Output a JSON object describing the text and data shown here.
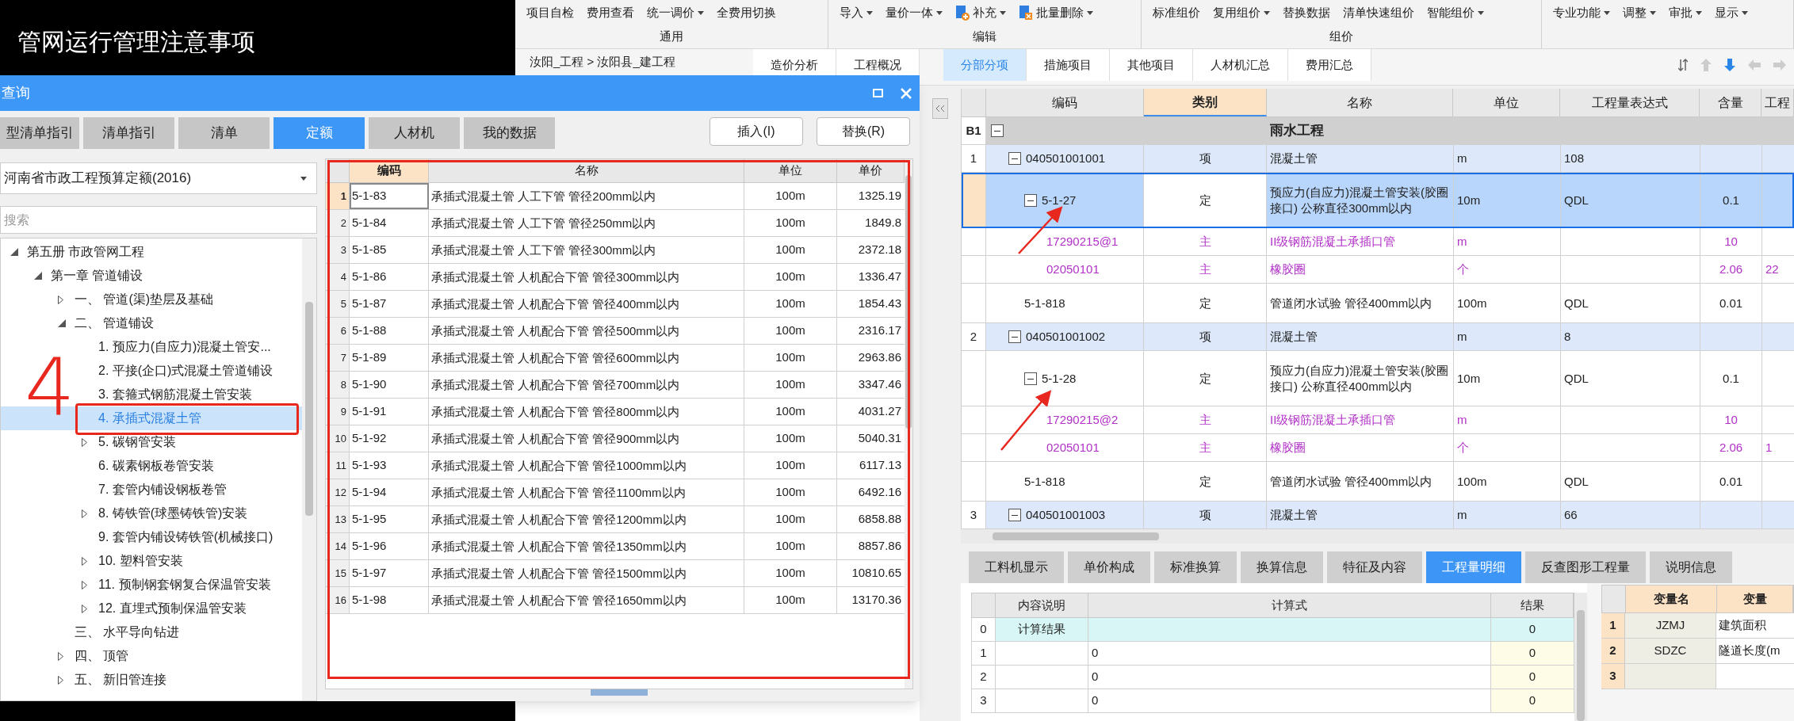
{
  "background_title": "管网运行管理注意事项",
  "ribbon": {
    "groups": [
      {
        "label": "通用",
        "items": [
          {
            "label": "项目自检",
            "dropdown": false
          },
          {
            "label": "费用查看",
            "dropdown": false
          },
          {
            "label": "统一调价",
            "dropdown": true
          },
          {
            "label": "全费用切换",
            "dropdown": false
          }
        ]
      },
      {
        "label": "编辑",
        "items": [
          {
            "label": "导入",
            "dropdown": true
          },
          {
            "label": "量价一体",
            "dropdown": true
          },
          {
            "label": "补充",
            "dropdown": true,
            "kind": "add"
          },
          {
            "label": "批量删除",
            "dropdown": true,
            "kind": "delete"
          }
        ]
      },
      {
        "label": "组价",
        "items": [
          {
            "label": "标准组价",
            "dropdown": false
          },
          {
            "label": "复用组价",
            "dropdown": true
          },
          {
            "label": "替换数据",
            "dropdown": false
          },
          {
            "label": "清单快速组价",
            "dropdown": false
          },
          {
            "label": "智能组价",
            "dropdown": true
          }
        ]
      },
      {
        "items": [
          {
            "label": "专业功能",
            "dropdown": true
          },
          {
            "label": "调整",
            "dropdown": true
          },
          {
            "label": "审批",
            "dropdown": true
          },
          {
            "label": "显示",
            "dropdown": true
          }
        ]
      }
    ]
  },
  "document_tabs": {
    "breadcrumb": "汝阳_工程 > 汝阳县_建工程",
    "tabs": [
      {
        "label": "造价分析",
        "selected": false
      },
      {
        "label": "工程概况",
        "selected": false
      },
      {
        "label": "分部分项",
        "selected": true
      },
      {
        "label": "措施项目",
        "selected": false
      },
      {
        "label": "其他项目",
        "selected": false
      },
      {
        "label": "人材机汇总",
        "selected": false
      },
      {
        "label": "费用汇总",
        "selected": false
      }
    ]
  },
  "grid": {
    "columns": [
      {
        "label": "编码",
        "selected": false
      },
      {
        "label": "类别",
        "selected": true
      },
      {
        "label": "名称",
        "selected": false
      },
      {
        "label": "单位",
        "selected": false
      },
      {
        "label": "工程量表达式",
        "selected": false
      },
      {
        "label": "含量",
        "selected": false
      },
      {
        "label": "工程",
        "selected": false
      }
    ],
    "rows": [
      {
        "kind": "section",
        "number": "B1",
        "name": "雨水工程",
        "expanded": true,
        "selected": false
      },
      {
        "kind": "item",
        "number": "1",
        "code": "040501001001",
        "type": "项",
        "name": "混凝土管",
        "unit": "m",
        "expression": "108",
        "expanded": true,
        "selected": false
      },
      {
        "kind": "quota",
        "code": "5-1-27",
        "type": "定",
        "name": "预应力(自应力)混凝土管安装(胶圈接口) 公称直径300mm以内",
        "unit": "10m",
        "expression": "QDL",
        "content": "0.1",
        "expanded": true,
        "selected": true
      },
      {
        "kind": "material",
        "code": "17290215@1",
        "type": "主",
        "name": "II级钢筋混凝土承插口管",
        "unit": "m",
        "content": "10",
        "selected": false
      },
      {
        "kind": "material",
        "code": "02050101",
        "type": "主",
        "name": "橡胶圈",
        "unit": "个",
        "content": "2.06",
        "column_8": "22",
        "selected": false
      },
      {
        "kind": "quota",
        "code": "5-1-818",
        "type": "定",
        "name": "管道闭水试验 管径400mm以内",
        "unit": "100m",
        "expression": "QDL",
        "content": "0.01",
        "selected": false
      },
      {
        "kind": "item",
        "number": "2",
        "code": "040501001002",
        "type": "项",
        "name": "混凝土管",
        "unit": "m",
        "expression": "8",
        "expanded": true,
        "selected": false
      },
      {
        "kind": "quota",
        "code": "5-1-28",
        "type": "定",
        "name": "预应力(自应力)混凝土管安装(胶圈接口) 公称直径400mm以内",
        "unit": "10m",
        "expression": "QDL",
        "content": "0.1",
        "expanded": true,
        "selected": false
      },
      {
        "kind": "material",
        "code": "17290215@2",
        "type": "主",
        "name": "II级钢筋混凝土承插口管",
        "unit": "m",
        "content": "10",
        "selected": false
      },
      {
        "kind": "material",
        "code": "02050101",
        "type": "主",
        "name": "橡胶圈",
        "unit": "个",
        "content": "2.06",
        "column_8": "1",
        "selected": false
      },
      {
        "kind": "quota",
        "code": "5-1-818",
        "type": "定",
        "name": "管道闭水试验 管径400mm以内",
        "unit": "100m",
        "expression": "QDL",
        "content": "0.01",
        "selected": false
      },
      {
        "kind": "item",
        "number": "3",
        "code": "040501001003",
        "type": "项",
        "name": "混凝土管",
        "unit": "m",
        "expression": "66",
        "expanded": true,
        "selected": false
      }
    ]
  },
  "bottom_panel": {
    "tabs": [
      {
        "label": "工料机显示",
        "selected": false
      },
      {
        "label": "单价构成",
        "selected": false
      },
      {
        "label": "标准换算",
        "selected": false
      },
      {
        "label": "换算信息",
        "selected": false
      },
      {
        "label": "特征及内容",
        "selected": false
      },
      {
        "label": "工程量明细",
        "selected": true
      },
      {
        "label": "反查图形工程量",
        "selected": false
      },
      {
        "label": "说明信息",
        "selected": false
      }
    ],
    "detail_table": {
      "columns": [
        "内容说明",
        "计算式",
        "结果"
      ],
      "rows": [
        {
          "kind": "total",
          "number": "0",
          "description": "计算结果",
          "result": "0"
        },
        {
          "kind": "line",
          "number": "1",
          "formula": "0",
          "result": "0"
        },
        {
          "kind": "line",
          "number": "2",
          "formula": "0",
          "result": "0"
        },
        {
          "kind": "line",
          "number": "3",
          "formula": "0",
          "result": "0"
        }
      ]
    },
    "variable_table": {
      "columns": [
        "变量名",
        "变量"
      ],
      "rows": [
        {
          "number": "1",
          "name": "JZMJ",
          "description": "建筑面积"
        },
        {
          "number": "2",
          "name": "SDZC",
          "description": "隧道长度(m"
        },
        {
          "number": "3"
        }
      ]
    }
  },
  "dialog": {
    "title": "查询",
    "tabs": [
      {
        "label": "型清单指引",
        "selected": false
      },
      {
        "label": "清单指引",
        "selected": false
      },
      {
        "label": "清单",
        "selected": false
      },
      {
        "label": "定额",
        "selected": true
      },
      {
        "label": "人材机",
        "selected": false
      },
      {
        "label": "我的数据",
        "selected": false
      }
    ],
    "buttons": [
      "插入(I)",
      "替换(R)"
    ],
    "library": "河南省市政工程预算定额(2016)",
    "search": {
      "placeholder": "搜索"
    },
    "tree": [
      {
        "label": "第五册 市政管网工程",
        "expanded": true,
        "selected": false,
        "children": [
          {
            "label": "第一章 管道铺设",
            "expanded": true,
            "selected": false,
            "children": [
              {
                "label": "一、  管道(渠)垫层及基础",
                "expanded": false,
                "selected": false
              },
              {
                "label": "二、  管道铺设",
                "expanded": true,
                "selected": false,
                "children": [
                  {
                    "label": "1. 预应力(自应力)混凝土管安...",
                    "selected": false
                  },
                  {
                    "label": "2. 平接(企口)式混凝土管道铺设",
                    "selected": false
                  },
                  {
                    "label": "3. 套箍式钢筋混凝土管安装",
                    "selected": false
                  },
                  {
                    "label": "4. 承插式混凝土管",
                    "selected": true
                  },
                  {
                    "label": "5. 碳钢管安装",
                    "expanded": false,
                    "selected": false
                  },
                  {
                    "label": "6. 碳素钢板卷管安装",
                    "selected": false
                  },
                  {
                    "label": "7. 套管内铺设钢板卷管",
                    "selected": false
                  },
                  {
                    "label": "8. 铸铁管(球墨铸铁管)安装",
                    "expanded": false,
                    "selected": false
                  },
                  {
                    "label": "9. 套管内铺设铸铁管(机械接口)",
                    "selected": false
                  },
                  {
                    "label": "10. 塑料管安装",
                    "expanded": false,
                    "selected": false
                  },
                  {
                    "label": "11. 预制钢套钢复合保温管安装",
                    "expanded": false,
                    "selected": false
                  },
                  {
                    "label": "12. 直埋式预制保温管安装",
                    "expanded": false,
                    "selected": false
                  }
                ]
              },
              {
                "label": "三、  水平导向钻进",
                "selected": false
              },
              {
                "label": "四、  顶管",
                "expanded": false,
                "selected": false
              },
              {
                "label": "五、  新旧管连接",
                "expanded": false,
                "selected": false
              }
            ]
          }
        ]
      }
    ],
    "quota_table": {
      "columns": [
        {
          "label": "编码",
          "selected": true
        },
        {
          "label": "名称",
          "selected": false
        },
        {
          "label": "单位",
          "selected": false
        },
        {
          "label": "单价",
          "selected": false
        }
      ],
      "rows": [
        {
          "number": "1",
          "code": "5-1-83",
          "name": "承插式混凝土管 人工下管 管径200mm以内",
          "unit": "100m",
          "price": "1325.19",
          "selected": true
        },
        {
          "number": "2",
          "code": "5-1-84",
          "name": "承插式混凝土管 人工下管 管径250mm以内",
          "unit": "100m",
          "price": "1849.8",
          "selected": false
        },
        {
          "number": "3",
          "code": "5-1-85",
          "name": "承插式混凝土管 人工下管 管径300mm以内",
          "unit": "100m",
          "price": "2372.18",
          "selected": false
        },
        {
          "number": "4",
          "code": "5-1-86",
          "name": "承插式混凝土管 人机配合下管 管径300mm以内",
          "unit": "100m",
          "price": "1336.47",
          "selected": false
        },
        {
          "number": "5",
          "code": "5-1-87",
          "name": "承插式混凝土管 人机配合下管 管径400mm以内",
          "unit": "100m",
          "price": "1854.43",
          "selected": false
        },
        {
          "number": "6",
          "code": "5-1-88",
          "name": "承插式混凝土管 人机配合下管 管径500mm以内",
          "unit": "100m",
          "price": "2316.17",
          "selected": false
        },
        {
          "number": "7",
          "code": "5-1-89",
          "name": "承插式混凝土管 人机配合下管 管径600mm以内",
          "unit": "100m",
          "price": "2963.86",
          "selected": false
        },
        {
          "number": "8",
          "code": "5-1-90",
          "name": "承插式混凝土管 人机配合下管 管径700mm以内",
          "unit": "100m",
          "price": "3347.46",
          "selected": false
        },
        {
          "number": "9",
          "code": "5-1-91",
          "name": "承插式混凝土管 人机配合下管 管径800mm以内",
          "unit": "100m",
          "price": "4031.27",
          "selected": false
        },
        {
          "number": "10",
          "code": "5-1-92",
          "name": "承插式混凝土管 人机配合下管 管径900mm以内",
          "unit": "100m",
          "price": "5040.31",
          "selected": false
        },
        {
          "number": "11",
          "code": "5-1-93",
          "name": "承插式混凝土管 人机配合下管 管径1000mm以内",
          "unit": "100m",
          "price": "6117.13",
          "selected": false
        },
        {
          "number": "12",
          "code": "5-1-94",
          "name": "承插式混凝土管 人机配合下管 管径1100mm以内",
          "unit": "100m",
          "price": "6492.16",
          "selected": false
        },
        {
          "number": "13",
          "code": "5-1-95",
          "name": "承插式混凝土管 人机配合下管 管径1200mm以内",
          "unit": "100m",
          "price": "6858.88",
          "selected": false
        },
        {
          "number": "14",
          "code": "5-1-96",
          "name": "承插式混凝土管 人机配合下管 管径1350mm以内",
          "unit": "100m",
          "price": "8857.86",
          "selected": false
        },
        {
          "number": "15",
          "code": "5-1-97",
          "name": "承插式混凝土管 人机配合下管 管径1500mm以内",
          "unit": "100m",
          "price": "10810.65",
          "selected": false
        },
        {
          "number": "16",
          "code": "5-1-98",
          "name": "承插式混凝土管 人机配合下管 管径1650mm以内",
          "unit": "100m",
          "price": "13170.36",
          "selected": false
        }
      ]
    },
    "annotation": "4"
  }
}
